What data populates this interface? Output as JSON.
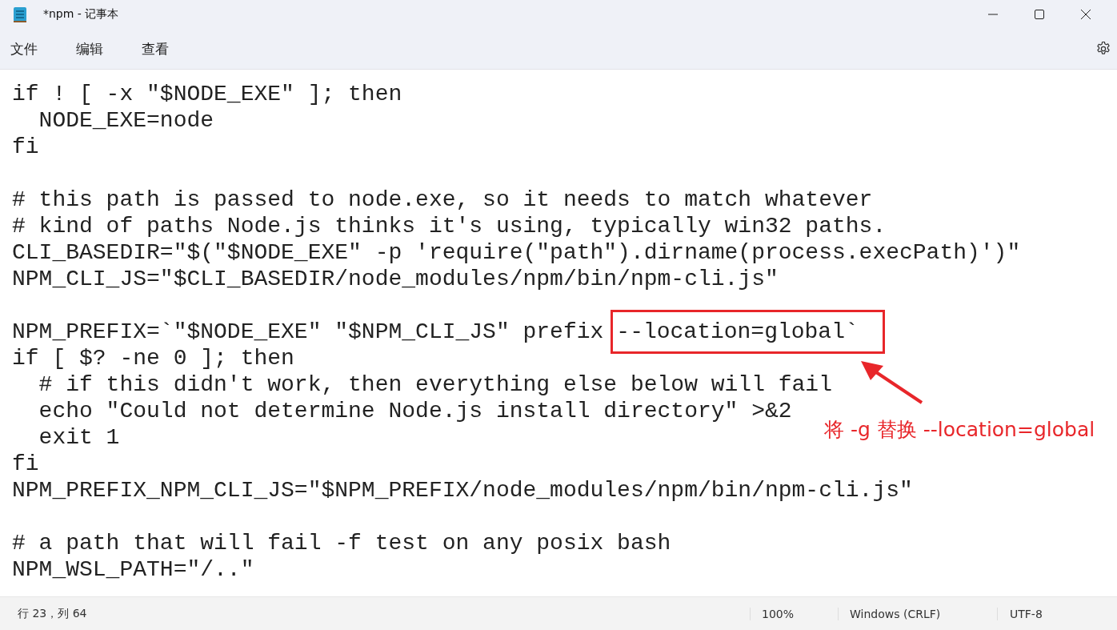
{
  "window": {
    "title": "*npm - 记事本"
  },
  "menu": [
    "文件",
    "编辑",
    "查看"
  ],
  "editor": {
    "blocks": [
      [
        "if ! [ -x \"$NODE_EXE\" ]; then",
        "  NODE_EXE=node",
        "fi"
      ],
      [
        "# this path is passed to node.exe, so it needs to match whatever",
        "# kind of paths Node.js thinks it's using, typically win32 paths.",
        "CLI_BASEDIR=\"$(\"$NODE_EXE\" -p 'require(\"path\").dirname(process.execPath)')\"",
        "NPM_CLI_JS=\"$CLI_BASEDIR/node_modules/npm/bin/npm-cli.js\""
      ],
      [
        {
          "text": "NPM_PREFIX=`\"$NODE_EXE\" \"$NPM_CLI_JS\" prefix",
          "highlighted": "--location=global`"
        },
        "if [ $? -ne 0 ]; then",
        "  # if this didn't work, then everything else below will fail",
        "  echo \"Could not determine Node.js install directory\" >&2",
        "  exit 1",
        "fi",
        "NPM_PREFIX_NPM_CLI_JS=\"$NPM_PREFIX/node_modules/npm/bin/npm-cli.js\""
      ],
      [
        "# a path that will fail -f test on any posix bash",
        "NPM_WSL_PATH=\"/..\""
      ]
    ]
  },
  "annotation": {
    "text": "将 -g 替换 --location=global"
  },
  "status_bar": [
    "行 23，列 64",
    "100%",
    "Windows (CRLF)",
    "UTF-8"
  ]
}
